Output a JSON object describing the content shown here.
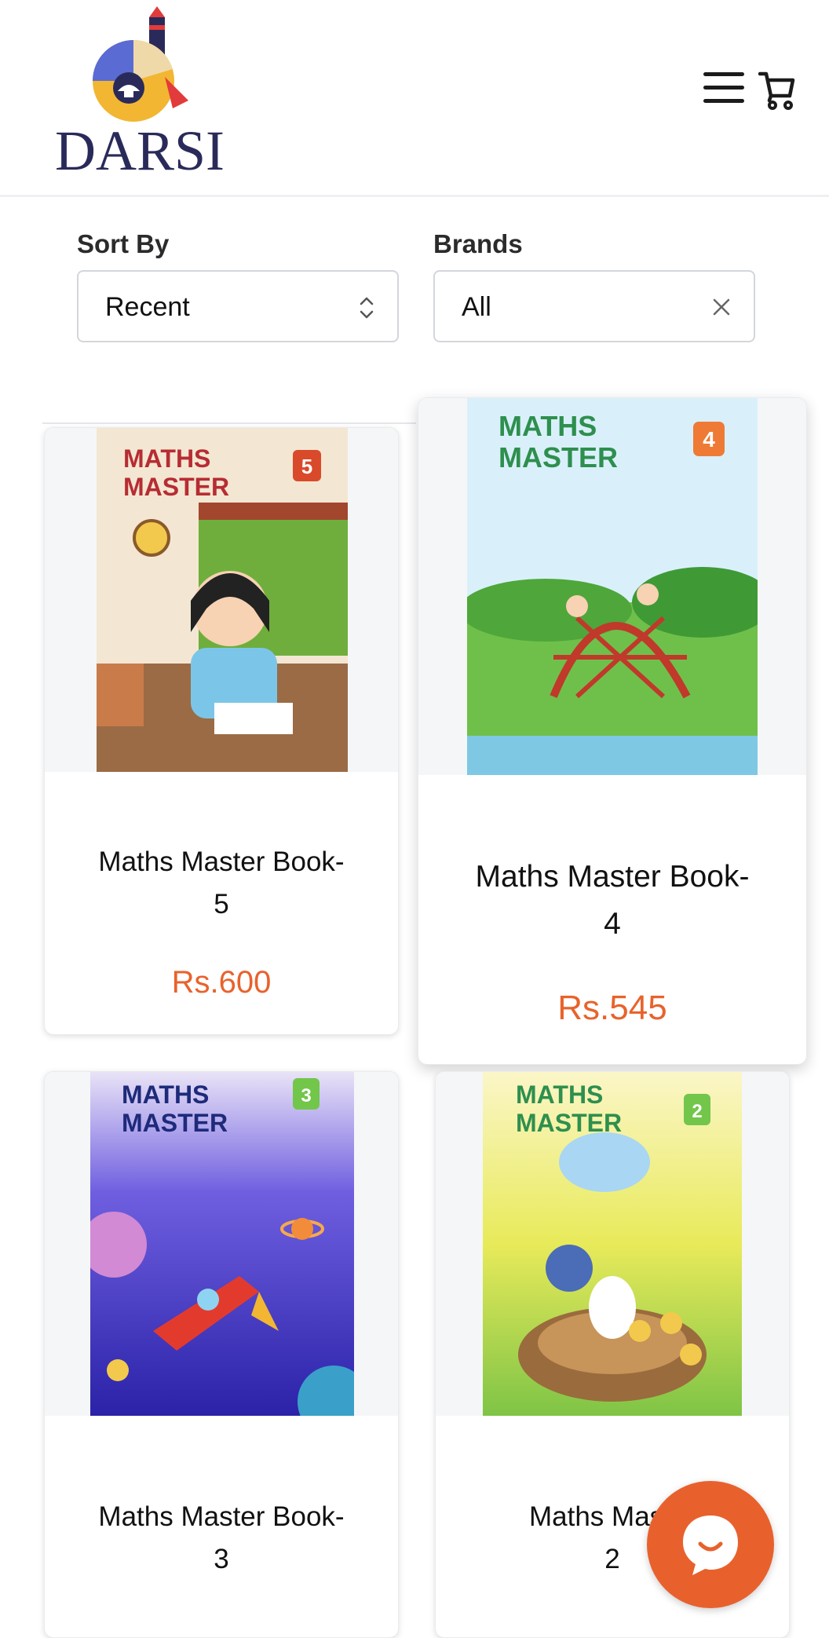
{
  "header": {
    "logo_text": "DARSI",
    "menu_icon": "hamburger-menu-icon",
    "cart_icon": "shopping-cart-icon"
  },
  "filters": {
    "sort": {
      "label": "Sort By",
      "value": "Recent"
    },
    "brands": {
      "label": "Brands",
      "value": "All"
    }
  },
  "products": [
    {
      "title_line1": "Maths Master Book-",
      "title_line2": "5",
      "price": "Rs.600",
      "cover_badge": "5",
      "cover_title1": "MATHS",
      "cover_title2": "MASTER"
    },
    {
      "title_line1": "Maths Master Book-",
      "title_line2": "4",
      "price": "Rs.545",
      "cover_badge": "4",
      "cover_title1": "MATHS",
      "cover_title2": "MASTER"
    },
    {
      "title_line1": "Maths Master Book-",
      "title_line2": "3",
      "price": "",
      "cover_badge": "3",
      "cover_title1": "MATHS",
      "cover_title2": "MASTER"
    },
    {
      "title_line1": "Maths Master",
      "title_line2": "2",
      "price": "",
      "cover_badge": "2",
      "cover_title1": "MATHS",
      "cover_title2": "MASTER"
    }
  ],
  "colors": {
    "accent": "#e8632c",
    "chat": "#e8612c"
  },
  "chat": {
    "icon": "chat-bubble-icon"
  }
}
